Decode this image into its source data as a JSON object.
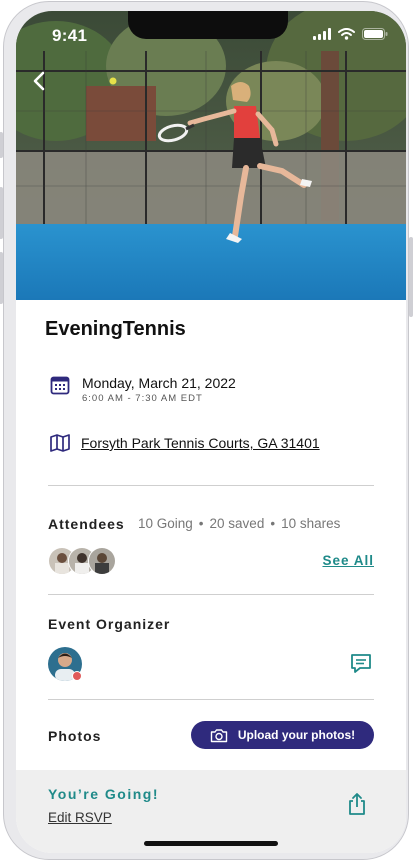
{
  "status_bar": {
    "time": "9:41"
  },
  "event": {
    "title": "EveningTennis",
    "date": "Monday, March 21, 2022",
    "time_range": "6:00 AM - 7:30 AM  EDT",
    "location": "Forsyth Park Tennis Courts, GA 31401"
  },
  "attendees": {
    "label": "Attendees",
    "going": "10 Going",
    "saved": "20 saved",
    "shares": "10 shares",
    "see_all": "See All"
  },
  "organizer": {
    "label": "Event Organizer"
  },
  "photos": {
    "label": "Photos",
    "upload_label": "Upload your photos!"
  },
  "footer": {
    "status": "You’re  Going!",
    "edit_rsvp": "Edit RSVP"
  },
  "colors": {
    "accent_teal": "#1f8a89",
    "primary_button": "#2f2a7d",
    "court_blue": "#1f86c8",
    "icon_navy": "#2f2a7d",
    "online_dot": "#e05a5a"
  },
  "icons": {
    "back": "chevron-left-icon",
    "calendar": "calendar-icon",
    "map": "map-icon",
    "chat": "chat-bubble-icon",
    "camera": "camera-icon",
    "share": "share-icon"
  }
}
